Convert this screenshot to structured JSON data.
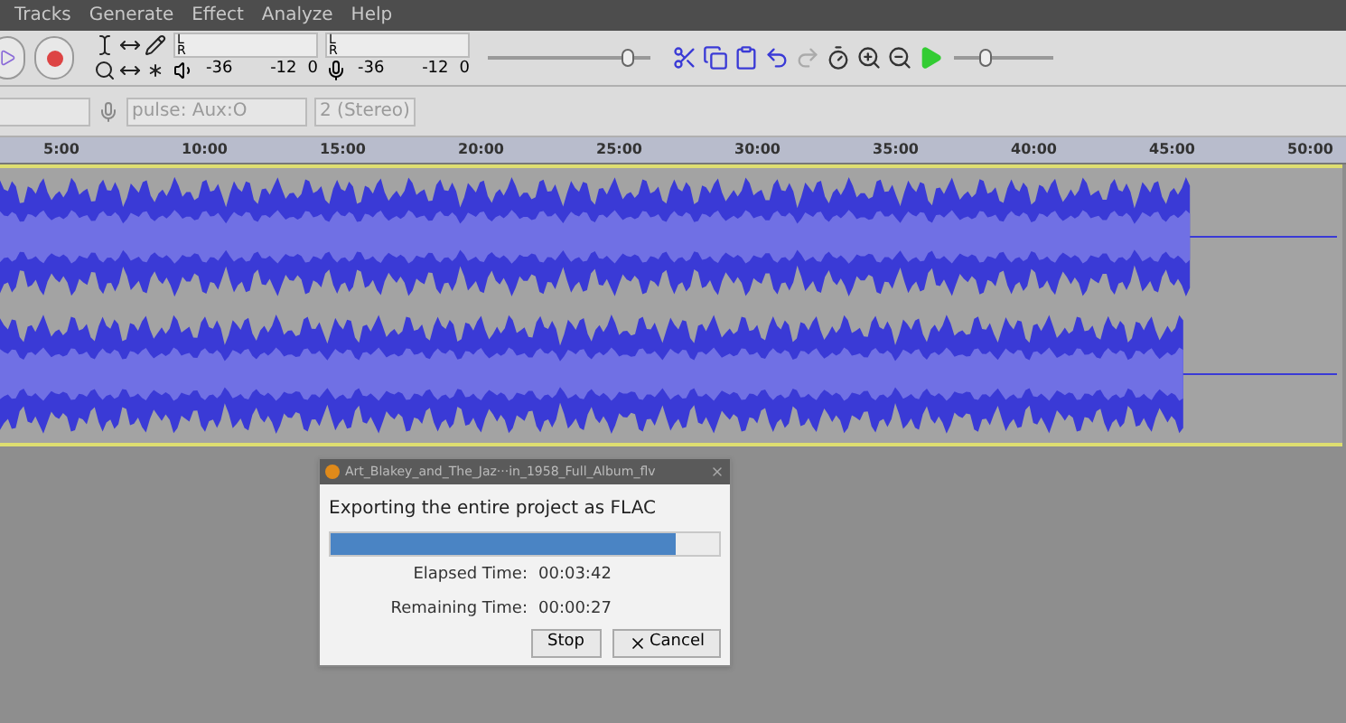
{
  "menu": [
    "Tracks",
    "Generate",
    "Effect",
    "Analyze",
    "Help"
  ],
  "meters": [
    {
      "channels": [
        "L",
        "R"
      ],
      "scale": [
        "-36",
        "-12",
        "0"
      ]
    },
    {
      "channels": [
        "L",
        "R"
      ],
      "scale": [
        "-36",
        "-12",
        "0"
      ]
    }
  ],
  "device_toolbar": {
    "input_device": "pulse: Aux:O",
    "channels": "2 (Stereo)"
  },
  "ruler": [
    "5:00",
    "10:00",
    "15:00",
    "20:00",
    "25:00",
    "30:00",
    "35:00",
    "40:00",
    "45:00",
    "50:00"
  ],
  "volume_slider": {
    "level": 0.85
  },
  "speed_slider": {
    "level": 0.3
  },
  "dialog": {
    "title": "Art_Blakey_and_The_Jaz···in_1958_Full_Album_flv",
    "message": "Exporting the entire project as FLAC",
    "progress": {
      "level": 0.89
    },
    "rows": [
      {
        "label": "Elapsed Time:",
        "value": "00:03:42"
      },
      {
        "label": "Remaining Time:",
        "value": "00:00:27"
      }
    ],
    "buttons": [
      {
        "kind": "plain",
        "label": "Stop"
      },
      {
        "kind": "cancel",
        "label": "Cancel"
      }
    ]
  }
}
